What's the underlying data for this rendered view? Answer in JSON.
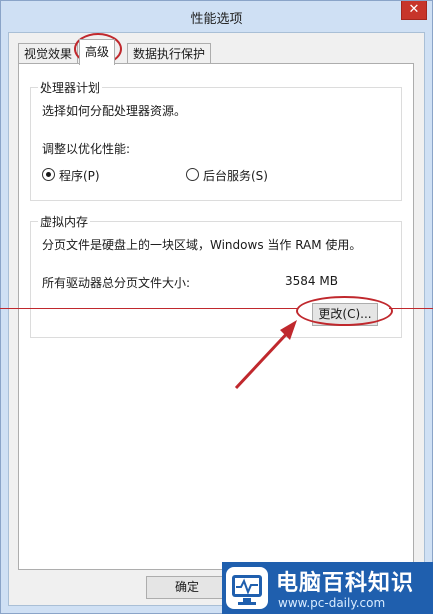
{
  "window": {
    "title": "性能选项",
    "close_glyph": "✕"
  },
  "tabs": [
    {
      "label": "视觉效果",
      "active": false
    },
    {
      "label": "高级",
      "active": true
    },
    {
      "label": "数据执行保护",
      "active": false
    }
  ],
  "processor": {
    "legend": "处理器计划",
    "description": "选择如何分配处理器资源。",
    "optimize_label": "调整以优化性能:",
    "options": [
      {
        "label": "程序(P)",
        "selected": true
      },
      {
        "label": "后台服务(S)",
        "selected": false
      }
    ]
  },
  "virtual_memory": {
    "legend": "虚拟内存",
    "description": "分页文件是硬盘上的一块区域，Windows 当作 RAM 使用。",
    "total_label": "所有驱动器总分页文件大小:",
    "total_value": "3584 MB",
    "change_button": "更改(C)..."
  },
  "footer": {
    "ok_button": "确定"
  },
  "watermark": {
    "name": "电脑百科知识",
    "url": "www.pc-daily.com"
  },
  "annotation_color": "#c0282d",
  "accent": "#1f5fae"
}
